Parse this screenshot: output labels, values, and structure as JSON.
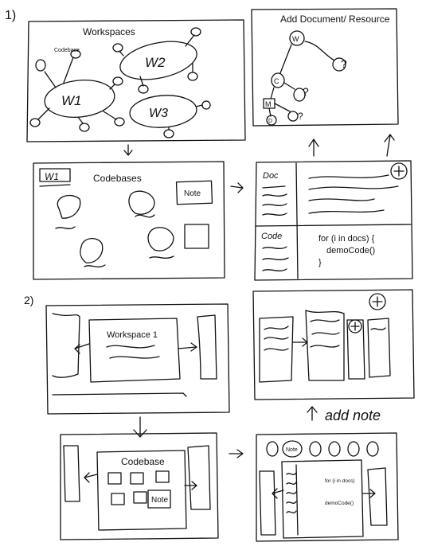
{
  "sections": [
    {
      "label": "1)"
    },
    {
      "label": "2)"
    }
  ],
  "panels": {
    "workspaces": {
      "title": "Workspaces",
      "codebase_label": "Codebase",
      "w1": "W1",
      "w2": "W2",
      "w3": "W3"
    },
    "add_resource": {
      "title": "Add Document/ Resource",
      "w": "W",
      "c": "C",
      "m": "M",
      "q1": "?",
      "q2": "?",
      "q3": "?",
      "d": "D"
    },
    "codebases": {
      "title": "Codebases",
      "ws_tag": "W1",
      "note": "Note"
    },
    "editor": {
      "doc_label": "Doc",
      "code_label": "Code",
      "code_line1": "for (i in docs) {",
      "code_line2": "demoCode()",
      "code_line3": "}"
    },
    "workspace1": {
      "title": "Workspace 1"
    },
    "codebase2": {
      "title": "Codebase",
      "note": "Note"
    },
    "editor2": {
      "note": "Note",
      "code_line1": "for (i in docs)",
      "code_line2": "demoCode()"
    }
  },
  "annotations": {
    "add_note": "add note"
  }
}
